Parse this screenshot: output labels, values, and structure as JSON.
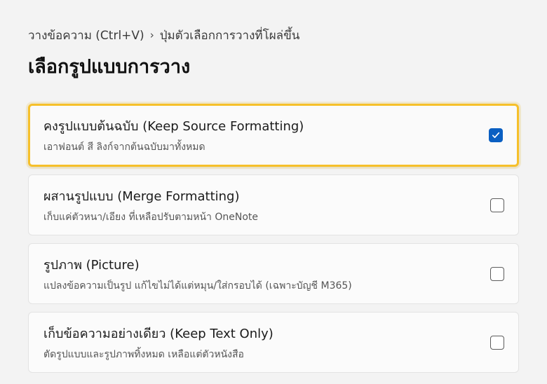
{
  "breadcrumb": {
    "parent": "วางข้อความ (Ctrl+V)",
    "separator": "›",
    "current": "ปุ่มตัวเลือกการวางที่โผล่ขึ้น"
  },
  "title": "เลือกรูปแบบการวาง",
  "colors": {
    "accent": "#0a5fc2",
    "selected_border": "#f6c02a",
    "background": "#f3f3f3"
  },
  "options": [
    {
      "title": "คงรูปแบบต้นฉบับ (Keep Source Formatting)",
      "description": "เอาฟอนต์ สี ลิงก์จากต้นฉบับมาทั้งหมด",
      "checked": true
    },
    {
      "title": "ผสานรูปแบบ (Merge Formatting)",
      "description": "เก็บแค่ตัวหนา/เอียง ที่เหลือปรับตามหน้า OneNote",
      "checked": false
    },
    {
      "title": "รูปภาพ (Picture)",
      "description": "แปลงข้อความเป็นรูป แก้ไขไม่ได้แต่หมุน/ใส่กรอบได้ (เฉพาะบัญชี M365)",
      "checked": false
    },
    {
      "title": "เก็บข้อความอย่างเดียว (Keep Text Only)",
      "description": "ตัดรูปแบบและรูปภาพทิ้งหมด เหลือแต่ตัวหนังสือ",
      "checked": false
    }
  ]
}
